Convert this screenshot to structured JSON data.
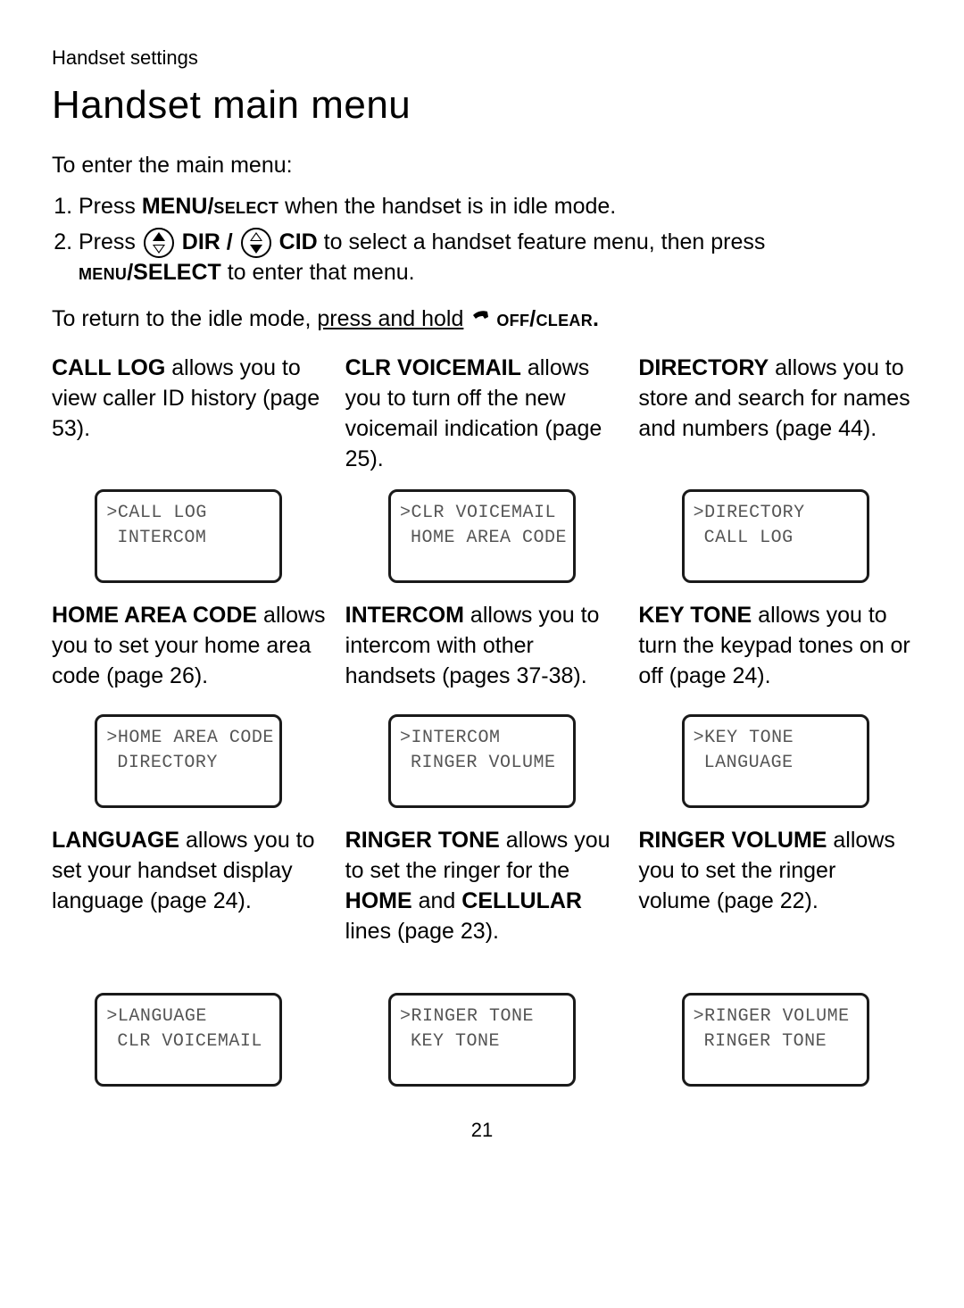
{
  "section_label": "Handset settings",
  "title": "Handset main menu",
  "intro": "To enter the main menu:",
  "step1": {
    "prefix": "Press ",
    "b1": "MENU/",
    "sc1": "select",
    "rest": " when the handset is in idle mode."
  },
  "step2": {
    "prefix": "Press ",
    "dir": " DIR / ",
    "cid": " CID",
    "mid": " to select a handset feature menu, then press ",
    "sc2_a": "menu",
    "sc2_b": "/SELECT",
    "tail": " to enter that menu."
  },
  "return_line": {
    "lead": "To return to the idle mode, ",
    "u": "press and hold",
    "tail_sc": "off/clear",
    "tail_b": "."
  },
  "items": [
    {
      "title": "CALL LOG",
      "desc": " allows you to view caller ID history (page 53).",
      "lcd1": ">CALL LOG",
      "lcd2": "INTERCOM"
    },
    {
      "title": "CLR VOICEMAIL",
      "desc": " allows you to turn off the new voicemail indication (page 25).",
      "lcd1": ">CLR VOICEMAIL",
      "lcd2": "HOME AREA CODE"
    },
    {
      "title": "DIRECTORY",
      "desc": " allows you to store and search for names and numbers (page 44).",
      "lcd1": ">DIRECTORY",
      "lcd2": "CALL LOG"
    },
    {
      "title": "HOME AREA CODE",
      "desc": " allows you to set your home area code (page 26).",
      "lcd1": ">HOME AREA CODE",
      "lcd2": "DIRECTORY"
    },
    {
      "title": "INTERCOM",
      "desc": " allows you to intercom with other handsets (pages 37-38).",
      "lcd1": ">INTERCOM",
      "lcd2": "RINGER VOLUME"
    },
    {
      "title": "KEY TONE",
      "desc": " allows you to turn the keypad tones on or off (page 24).",
      "lcd1": ">KEY TONE",
      "lcd2": "LANGUAGE"
    },
    {
      "title": "LANGUAGE",
      "desc": " allows you to set your handset display language (page 24).",
      "lcd1": ">LANGUAGE",
      "lcd2": "CLR VOICEMAIL"
    },
    {
      "title": "RINGER TONE",
      "desc_pre": " allows you to set the ringer for the ",
      "b1": "HOME",
      "mid": " and ",
      "b2": "CELLULAR",
      "desc_post": " lines (page 23).",
      "lcd1": ">RINGER TONE",
      "lcd2": "KEY TONE"
    },
    {
      "title": "RINGER VOLUME",
      "desc": " allows you to set the ringer volume (page 22).",
      "lcd1": ">RINGER VOLUME",
      "lcd2": "RINGER TONE"
    }
  ],
  "page_number": "21"
}
